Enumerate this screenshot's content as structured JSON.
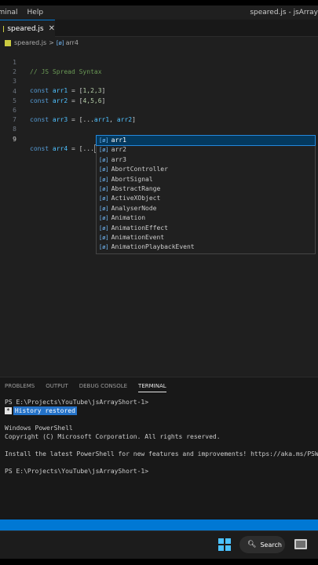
{
  "menubar": {
    "items": [
      "rminal",
      "Help"
    ],
    "window_title": "speared.js - jsArray"
  },
  "tab": {
    "filename": "speared.js",
    "close": "✕"
  },
  "breadcrumb": {
    "file": "speared.js",
    "separator": ">",
    "symbol_icon": "[ø]",
    "symbol": "arr4"
  },
  "editor": {
    "lines": [
      {
        "n": "1",
        "comment": "// JS Spread Syntax"
      },
      {
        "n": "2"
      },
      {
        "n": "3",
        "kw": "const",
        "name": "arr1",
        "eq": " = [",
        "vals": "1,2,3",
        "end": "]"
      },
      {
        "n": "4",
        "kw": "const",
        "name": "arr2",
        "eq": " = [",
        "vals": "4,5,6",
        "end": "]"
      },
      {
        "n": "5"
      },
      {
        "n": "6",
        "kw": "const",
        "name": "arr3",
        "eq": " = [...",
        "v1": "arr1",
        "comma": ", ",
        "v2": "arr2",
        "end": "]"
      },
      {
        "n": "7"
      },
      {
        "n": "8"
      },
      {
        "n": "9",
        "kw": "const",
        "name": "arr4",
        "eq": " = [...",
        "end": "]"
      }
    ]
  },
  "suggestions": {
    "icon": "[ø]",
    "items": [
      "arr1",
      "arr2",
      "arr3",
      "AbortController",
      "AbortSignal",
      "AbstractRange",
      "ActiveXObject",
      "AnalyserNode",
      "Animation",
      "AnimationEffect",
      "AnimationEvent",
      "AnimationPlaybackEvent"
    ]
  },
  "panel": {
    "tabs": [
      "PROBLEMS",
      "OUTPUT",
      "DEBUG CONSOLE",
      "TERMINAL"
    ],
    "active_tab": "TERMINAL"
  },
  "terminal": {
    "prompt1": "PS E:\\Projects\\YouTube\\jsArrayShort-1>",
    "history_star": "*",
    "history": "History restored",
    "ps_title": "Windows PowerShell",
    "copyright": "Copyright (C) Microsoft Corporation. All rights reserved.",
    "install": "Install the latest PowerShell for new features and improvements! https://aka.ms/PSWindows",
    "prompt2": "PS E:\\Projects\\YouTube\\jsArrayShort-1>"
  },
  "taskbar": {
    "search_label": "Search"
  },
  "icons": {
    "windows": "windows-logo-icon",
    "search": "search-icon",
    "app": "tv-app-icon"
  },
  "colors": {
    "accent": "#0078d4",
    "keyword": "#569cd6",
    "variable": "#4fc1ff",
    "number": "#b5cea8",
    "comment": "#6a9955"
  }
}
